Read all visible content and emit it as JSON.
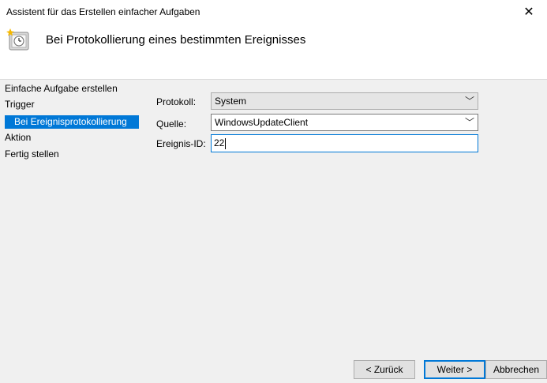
{
  "window": {
    "title": "Assistent für das Erstellen einfacher Aufgaben"
  },
  "header": {
    "title": "Bei Protokollierung eines bestimmten Ereignisses",
    "icon": "scheduled-task-clock-icon"
  },
  "sidebar": {
    "items": [
      {
        "label": "Einfache Aufgabe erstellen"
      },
      {
        "label": "Trigger"
      },
      {
        "label": "Bei Ereignisprotokollierung",
        "selected": true
      },
      {
        "label": "Aktion"
      },
      {
        "label": "Fertig stellen"
      }
    ]
  },
  "form": {
    "protokoll": {
      "label": "Protokoll:",
      "value": "System"
    },
    "quelle": {
      "label": "Quelle:",
      "value": "WindowsUpdateClient"
    },
    "ereignis_id": {
      "label": "Ereignis-ID:",
      "value": "22"
    }
  },
  "buttons": {
    "back": "< Zurück",
    "next": "Weiter >",
    "cancel": "Abbrechen"
  },
  "colors": {
    "accent": "#0078d7",
    "background": "#f0f0f0"
  }
}
